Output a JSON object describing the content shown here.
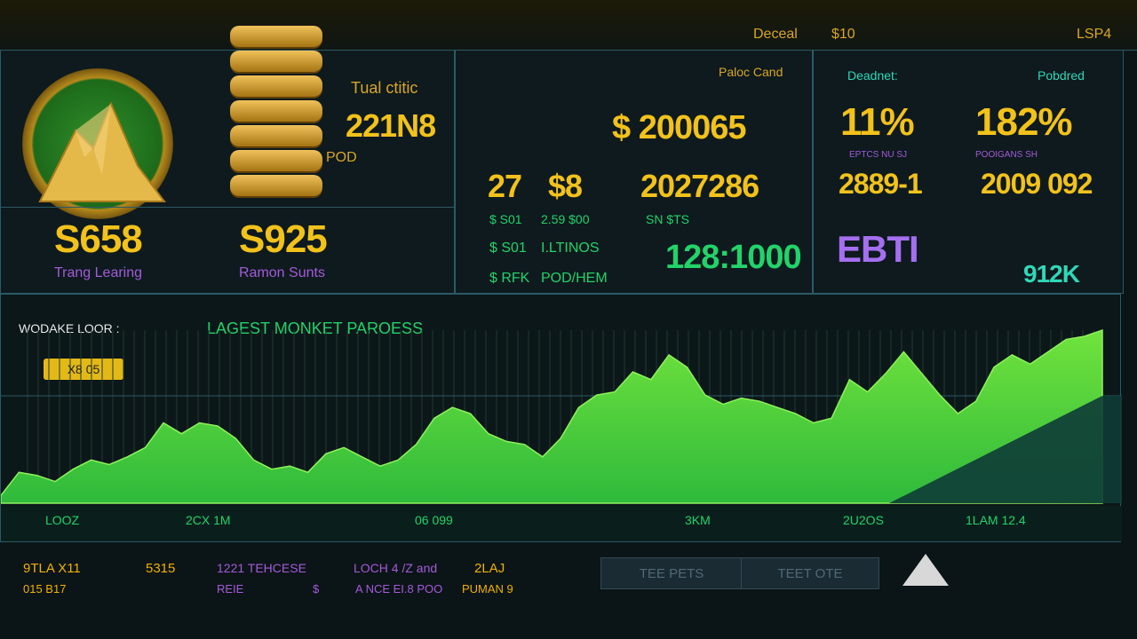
{
  "topbar": {
    "label1": "Deceal",
    "value1": "$10",
    "label2": "LSP4"
  },
  "left_panel": {
    "title": "Tual ctitic",
    "big_value": "221N8",
    "stack_label": "POD",
    "metric1_value": "S658",
    "metric1_label": "Trang Learing",
    "metric2_value": "S925",
    "metric2_label": "Ramon Sunts"
  },
  "center_panel": {
    "header": "Paloc Cand",
    "main_value": "$ 200065",
    "row1_a": "27",
    "row1_b": "$8",
    "row1_c": "2027286",
    "list": [
      {
        "a": "$ S01",
        "b": "2.59 $00"
      },
      {
        "a": "$ S01",
        "b": "I.LTINOS"
      },
      {
        "a": "$ RFK",
        "b": "POD/HEM"
      }
    ],
    "list_right_label": "SN $TS",
    "ratio": "128:1000"
  },
  "right_panel": {
    "label1": "Deadnet:",
    "label2": "Pobdred",
    "pct1": "11%",
    "pct2": "182%",
    "sub1": "EPTCS NU SJ",
    "sub2": "POOIGANS SH",
    "val1": "2889-1",
    "val2": "2009 092",
    "badge": "EBTI",
    "count": "912K"
  },
  "chart": {
    "left_label": "WODAKE LOOR :",
    "title": "LAGEST MONKET PAROESS",
    "badge": "X8 05",
    "x_ticks": [
      "LOOZ",
      "2CX 1M",
      "06 099",
      "3KM",
      "2U2OS",
      "1LAM 12.4"
    ]
  },
  "footer": {
    "col1_a": "9TLA X11",
    "col1_b": "015 B17",
    "col2_a": "5315",
    "col3_a": "1221 TEHCESE",
    "col3_b": "REIE",
    "col3_c": "$",
    "col4_a": "LOCH 4 /Z and",
    "col4_b": "A NCE EI.8 POO",
    "col5_a": "2LAJ",
    "col5_b": "PUMAN 9",
    "btn1": "TEE PETS",
    "btn2": "TEET OTE"
  },
  "chart_data": {
    "type": "area",
    "values": [
      5,
      20,
      18,
      14,
      22,
      28,
      25,
      30,
      36,
      52,
      45,
      52,
      50,
      42,
      28,
      22,
      24,
      20,
      32,
      36,
      30,
      24,
      28,
      38,
      55,
      62,
      58,
      45,
      40,
      38,
      30,
      42,
      62,
      70,
      72,
      85,
      80,
      96,
      88,
      70,
      64,
      68,
      66,
      62,
      58,
      52,
      55,
      80,
      72,
      84,
      98,
      84,
      70,
      58,
      66,
      88,
      96,
      90,
      98,
      106,
      108,
      112
    ],
    "grid": true
  }
}
